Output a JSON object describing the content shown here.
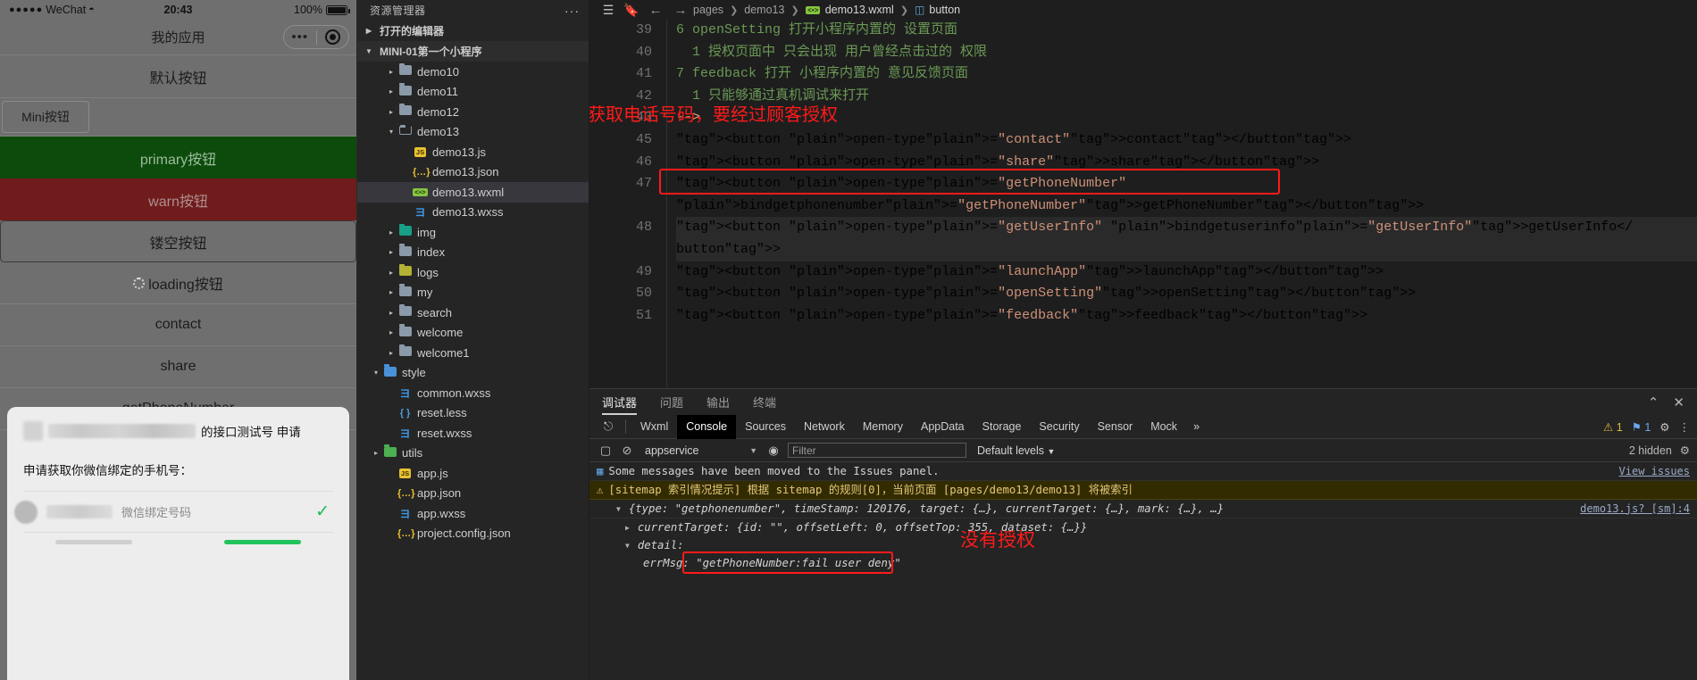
{
  "simulator": {
    "status": {
      "signal": "●●●●●",
      "carrier": "WeChat",
      "wifi": "wifi-icon",
      "time": "20:43",
      "battery": "100%"
    },
    "nav_title": "我的应用",
    "capsule": {
      "more": "•••",
      "target": "target-icon"
    },
    "buttons": [
      {
        "label": "默认按钮",
        "style": "default"
      },
      {
        "label": "Mini按钮",
        "style": "mini"
      },
      {
        "label": "primary按钮",
        "style": "primary"
      },
      {
        "label": "warn按钮",
        "style": "warn"
      },
      {
        "label": "镂空按钮",
        "style": "hollow"
      },
      {
        "label": "loading按钮",
        "style": "loading"
      },
      {
        "label": "contact",
        "style": "default"
      },
      {
        "label": "share",
        "style": "default"
      },
      {
        "label": "getPhoneNumber",
        "style": "default"
      }
    ],
    "modal": {
      "header_suffix": "的接口测试号 申请",
      "subtitle": "申请获取你微信绑定的手机号：",
      "placeholder": "微信绑定号码",
      "check": "✓"
    }
  },
  "explorer": {
    "title": "资源管理器",
    "more": "···",
    "sections": [
      {
        "label": "打开的编辑器",
        "expanded": false
      },
      {
        "label": "MINI-01第一个小程序",
        "expanded": true
      }
    ],
    "tree": [
      {
        "label": "demo10",
        "icon": "folder",
        "depth": 1,
        "twisty": "▸",
        "selected": false
      },
      {
        "label": "demo11",
        "icon": "folder",
        "depth": 1,
        "twisty": "▸",
        "selected": false
      },
      {
        "label": "demo12",
        "icon": "folder",
        "depth": 1,
        "twisty": "▸",
        "selected": false
      },
      {
        "label": "demo13",
        "icon": "folder-open",
        "depth": 1,
        "twisty": "▾",
        "selected": false
      },
      {
        "label": "demo13.js",
        "icon": "js-icon",
        "depth": 2,
        "twisty": "",
        "selected": false
      },
      {
        "label": "demo13.json",
        "icon": "json-icon",
        "depth": 2,
        "twisty": "",
        "selected": false
      },
      {
        "label": "demo13.wxml",
        "icon": "wxml-icon",
        "depth": 2,
        "twisty": "",
        "selected": true
      },
      {
        "label": "demo13.wxss",
        "icon": "wxss-icon",
        "depth": 2,
        "twisty": "",
        "selected": false
      },
      {
        "label": "img",
        "icon": "folder-img",
        "depth": 1,
        "twisty": "▸",
        "selected": false
      },
      {
        "label": "index",
        "icon": "folder",
        "depth": 1,
        "twisty": "▸",
        "selected": false
      },
      {
        "label": "logs",
        "icon": "folder-logs",
        "depth": 1,
        "twisty": "▸",
        "selected": false
      },
      {
        "label": "my",
        "icon": "folder",
        "depth": 1,
        "twisty": "▸",
        "selected": false
      },
      {
        "label": "search",
        "icon": "folder",
        "depth": 1,
        "twisty": "▸",
        "selected": false
      },
      {
        "label": "welcome",
        "icon": "folder",
        "depth": 1,
        "twisty": "▸",
        "selected": false
      },
      {
        "label": "welcome1",
        "icon": "folder",
        "depth": 1,
        "twisty": "▸",
        "selected": false
      },
      {
        "label": "style",
        "icon": "folder-style",
        "depth": 0,
        "twisty": "▾",
        "selected": false
      },
      {
        "label": "common.wxss",
        "icon": "wxss-icon",
        "depth": 1,
        "twisty": "",
        "selected": false
      },
      {
        "label": "reset.less",
        "icon": "less-icon",
        "depth": 1,
        "twisty": "",
        "selected": false
      },
      {
        "label": "reset.wxss",
        "icon": "wxss-icon",
        "depth": 1,
        "twisty": "",
        "selected": false
      },
      {
        "label": "utils",
        "icon": "folder-utils",
        "depth": 0,
        "twisty": "▸",
        "selected": false
      },
      {
        "label": "app.js",
        "icon": "js-icon",
        "depth": 1,
        "twisty": "",
        "selected": false
      },
      {
        "label": "app.json",
        "icon": "json-icon",
        "depth": 1,
        "twisty": "",
        "selected": false
      },
      {
        "label": "app.wxss",
        "icon": "wxss-icon",
        "depth": 1,
        "twisty": "",
        "selected": false
      },
      {
        "label": "project.config.json",
        "icon": "json-icon",
        "depth": 1,
        "twisty": "",
        "selected": false
      }
    ]
  },
  "editor": {
    "toolbar": {
      "outline": "list-icon",
      "bookmark": "bookmark-icon",
      "back": "←",
      "forward": "→"
    },
    "breadcrumb": [
      {
        "label": "pages",
        "icon": ""
      },
      {
        "label": "demo13",
        "icon": ""
      },
      {
        "label": "demo13.wxml",
        "icon": "wxml-icon"
      },
      {
        "label": "button",
        "icon": "cube-icon"
      }
    ],
    "lines": [
      {
        "no": "39",
        "text": "6 openSetting 打开小程序内置的 设置页面",
        "kind": "comment"
      },
      {
        "no": "40",
        "text": "  1 授权页面中 只会出现 用户曾经点击过的 权限",
        "kind": "comment"
      },
      {
        "no": "41",
        "text": "7 feedback 打开 小程序内置的 意见反馈页面",
        "kind": "comment"
      },
      {
        "no": "42",
        "text": "  1 只能够通过真机调试来打开",
        "kind": "comment"
      },
      {
        "no": "43",
        "text": "-->",
        "kind": "comment-end"
      },
      {
        "no": "45",
        "text": "<button open-type=\"contact\">contact</button>",
        "kind": "code"
      },
      {
        "no": "46",
        "text": "<button open-type=\"share\">share</button>",
        "kind": "code"
      },
      {
        "no": "47",
        "text": "<button open-type=\"getPhoneNumber\"",
        "kind": "code"
      },
      {
        "no": "",
        "text": "bindgetphonenumber=\"getPhoneNumber\">getPhoneNumber</button>",
        "kind": "code"
      },
      {
        "no": "48",
        "text": "<button open-type=\"getUserInfo\" bindgetuserinfo=\"getUserInfo\">getUserInfo</",
        "kind": "code-hl"
      },
      {
        "no": "",
        "text": "button>",
        "kind": "code-hl"
      },
      {
        "no": "49",
        "text": "<button open-type=\"launchApp\">launchApp</button>",
        "kind": "code"
      },
      {
        "no": "50",
        "text": "<button open-type=\"openSetting\">openSetting</button>",
        "kind": "code"
      },
      {
        "no": "51",
        "text": "<button open-type=\"feedback\">feedback</button>",
        "kind": "code"
      }
    ],
    "annotation_top": "获取电话号码，要经过顾客授权"
  },
  "devtools": {
    "panel_tabs": [
      {
        "label": "调试器",
        "active": true
      },
      {
        "label": "问题",
        "active": false
      },
      {
        "label": "输出",
        "active": false
      },
      {
        "label": "终端",
        "active": false
      }
    ],
    "panel_actions": {
      "collapse": "⌃",
      "close": "✕"
    },
    "tabs": [
      {
        "label": "Wxml",
        "active": false
      },
      {
        "label": "Console",
        "active": true
      },
      {
        "label": "Sources",
        "active": false
      },
      {
        "label": "Network",
        "active": false
      },
      {
        "label": "Memory",
        "active": false
      },
      {
        "label": "AppData",
        "active": false
      },
      {
        "label": "Storage",
        "active": false
      },
      {
        "label": "Security",
        "active": false
      },
      {
        "label": "Sensor",
        "active": false
      },
      {
        "label": "Mock",
        "active": false
      }
    ],
    "tabs_overflow": "»",
    "inspect_icon": "inspect-icon",
    "warning_count": "1",
    "message_count": "1",
    "settings_icon": "gear-icon",
    "kebab_icon": "kebab-icon",
    "console_bar": {
      "sidebar_icon": "panel-icon",
      "clear_icon": "clear-icon",
      "context": "appservice",
      "eye_icon": "eye-icon",
      "filter_placeholder": "Filter",
      "levels": "Default levels",
      "hidden": "2 hidden",
      "settings_icon": "gear-icon"
    },
    "logs": [
      {
        "type": "info",
        "text": "Some messages have been moved to the Issues panel.",
        "link": "View issues"
      },
      {
        "type": "warn",
        "text": "[sitemap 索引情况提示] 根据 sitemap 的规则[0]，当前页面 [pages/demo13/demo13] 将被索引",
        "link": ""
      },
      {
        "type": "obj",
        "text": "{type: \"getphonenumber\", timeStamp: 120176, target: {…}, currentTarget: {…}, mark: {…}, …}",
        "link": "demo13.js? [sm]:4"
      },
      {
        "type": "sub",
        "text": "currentTarget: {id: \"\", offsetLeft: 0, offsetTop: 355, dataset: {…}}",
        "link": ""
      },
      {
        "type": "sub2",
        "text": "detail:",
        "link": ""
      },
      {
        "type": "sub3",
        "text": "errMsg: \"getPhoneNumber:fail user deny\"",
        "link": ""
      }
    ],
    "annotation_bottom": "没有授权"
  },
  "colors": {
    "accent_red": "#ff1a1a",
    "primary_green": "#0c4b0c",
    "warn_red": "#701c1c",
    "check_green": "#19b955"
  }
}
